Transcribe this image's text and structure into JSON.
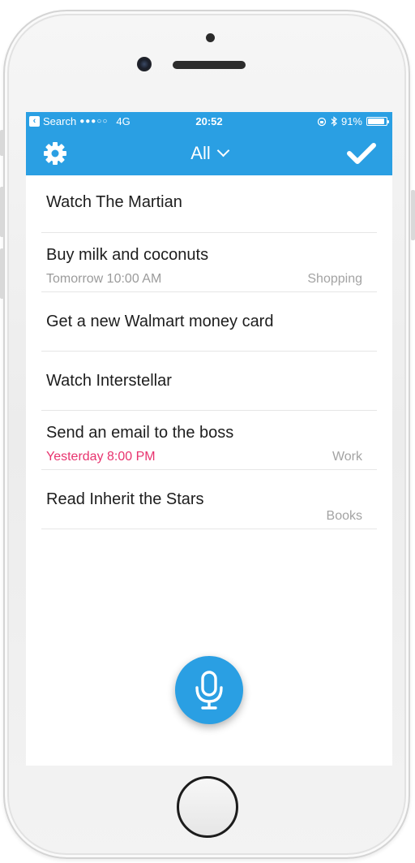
{
  "status": {
    "back_label": "Search",
    "carrier_dots": "●●●○○",
    "network": "4G",
    "time": "20:52",
    "battery": "91%",
    "battery_level": 0.91,
    "rotation_lock_icon": "rotation-lock-icon",
    "bluetooth_icon": "bluetooth-icon"
  },
  "navbar": {
    "title": "All",
    "settings_icon": "gear-icon",
    "done_icon": "checkmark-icon"
  },
  "tasks": [
    {
      "title": "Watch The Martian",
      "due": "",
      "list": ""
    },
    {
      "title": "Buy milk and coconuts",
      "due": "Tomorrow 10:00 AM",
      "list": "Shopping",
      "overdue": false
    },
    {
      "title": "Get a new Walmart money card",
      "due": "",
      "list": ""
    },
    {
      "title": "Watch Interstellar",
      "due": "",
      "list": ""
    },
    {
      "title": "Send an email to the boss",
      "due": "Yesterday 8:00 PM",
      "list": "Work",
      "overdue": true
    },
    {
      "title": "Read Inherit the Stars",
      "due": "",
      "list": "Books"
    }
  ],
  "voice_button_icon": "microphone-icon",
  "colors": {
    "accent": "#2a9fe3",
    "overdue": "#e8336e",
    "secondary_text": "#9b9b9b"
  }
}
